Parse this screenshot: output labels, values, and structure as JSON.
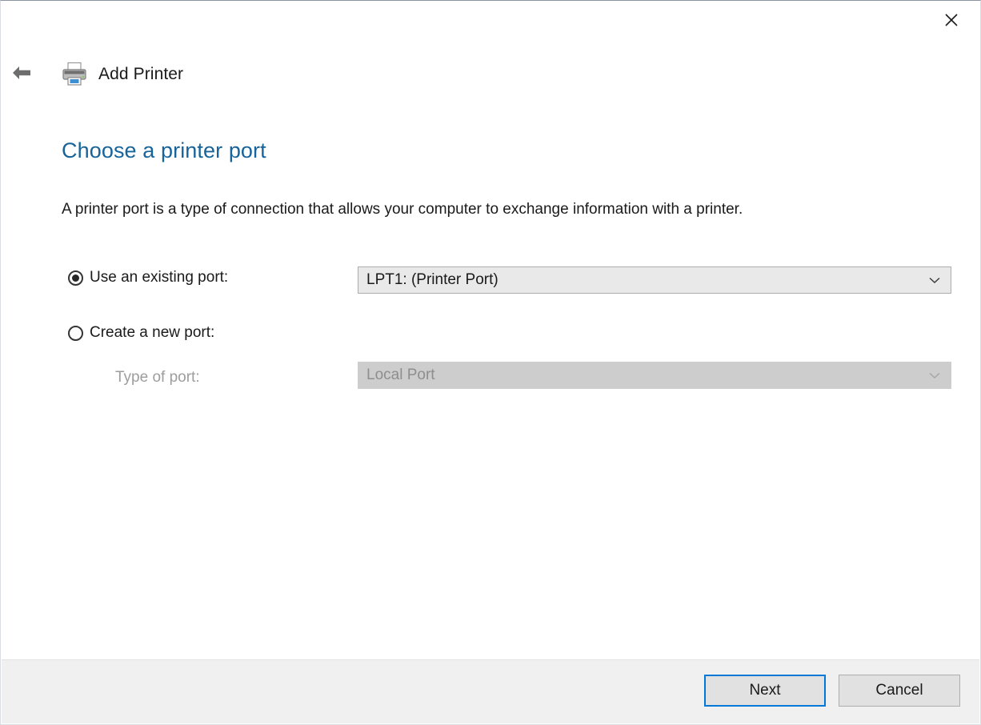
{
  "window": {
    "title": "Add Printer",
    "title_icon": "printer-icon",
    "back_icon": "back-arrow-icon",
    "close_icon": "close-icon"
  },
  "content": {
    "heading": "Choose a printer port",
    "description": "A printer port is a type of connection that allows your computer to exchange information with a printer.",
    "heading_color": "#17649b"
  },
  "form": {
    "existing_port": {
      "radio_label": "Use an existing port:",
      "radio_selected": true,
      "combo_value": "LPT1: (Printer Port)",
      "combo_icon": "chevron-down-icon",
      "enabled": true
    },
    "new_port": {
      "radio_label": "Create a new port:",
      "radio_selected": false,
      "type_label": "Type of port:",
      "combo_value": "Local Port",
      "combo_icon": "chevron-down-icon",
      "enabled": false
    }
  },
  "footer": {
    "next_label": "Next",
    "cancel_label": "Cancel",
    "default_button_accent": "#0078d7"
  }
}
